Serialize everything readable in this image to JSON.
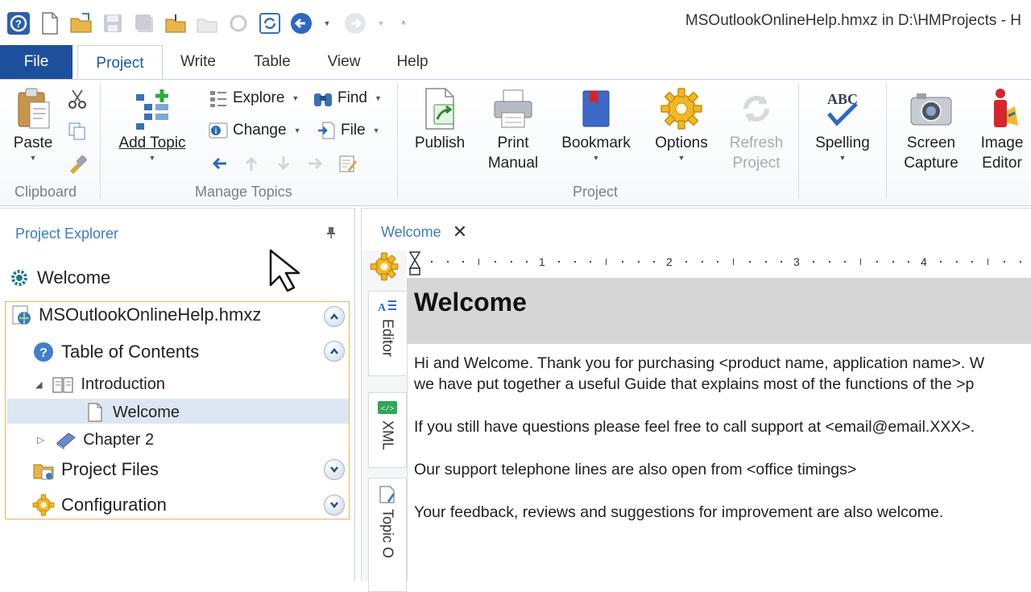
{
  "window": {
    "title": "MSOutlookOnlineHelp.hmxz in D:\\HMProjects - H"
  },
  "ribbon_tabs": {
    "file": "File",
    "tabs": [
      "Project",
      "Write",
      "Table",
      "View",
      "Help"
    ]
  },
  "ribbon": {
    "clipboard": {
      "paste": "Paste",
      "group": "Clipboard"
    },
    "manage_topics": {
      "add_topic": "Add Topic",
      "explore": "Explore",
      "find": "Find",
      "change": "Change",
      "file": "File",
      "group": "Manage Topics"
    },
    "project": {
      "publish": "Publish",
      "print_manual_1": "Print",
      "print_manual_2": "Manual",
      "bookmark": "Bookmark",
      "options": "Options",
      "refresh_1": "Refresh",
      "refresh_2": "Project",
      "group": "Project"
    },
    "tools": {
      "spelling": "Spelling",
      "screen_capture_1": "Screen",
      "screen_capture_2": "Capture",
      "image_editor_1": "Image",
      "image_editor_2": "Editor"
    }
  },
  "explorer": {
    "title": "Project Explorer",
    "welcome_top": "Welcome",
    "project_file": "MSOutlookOnlineHelp.hmxz",
    "toc": "Table of Contents",
    "introduction": "Introduction",
    "welcome_child": "Welcome",
    "chapter2": "Chapter 2",
    "project_files": "Project Files",
    "configuration": "Configuration"
  },
  "editor": {
    "doc_tab": "Welcome",
    "side_tabs": [
      "Editor",
      "XML",
      "Topic O"
    ],
    "ruler_numbers": [
      "1",
      "2",
      "3",
      "4"
    ],
    "heading": "Welcome",
    "paragraphs": [
      "Hi and Welcome. Thank you for purchasing <product name, application name>. W",
      "we have put together a useful Guide that explains most of the functions of the >p",
      "If you still have questions please feel free to call support at <email@email.XXX>.",
      "Our support telephone lines are also open from <office timings>",
      "Your feedback, reviews and suggestions for improvement are also welcome."
    ]
  },
  "colors": {
    "file_tab": "#1c4f9c",
    "accent_text": "#3a7bbf",
    "project_border": "#e8b463"
  }
}
